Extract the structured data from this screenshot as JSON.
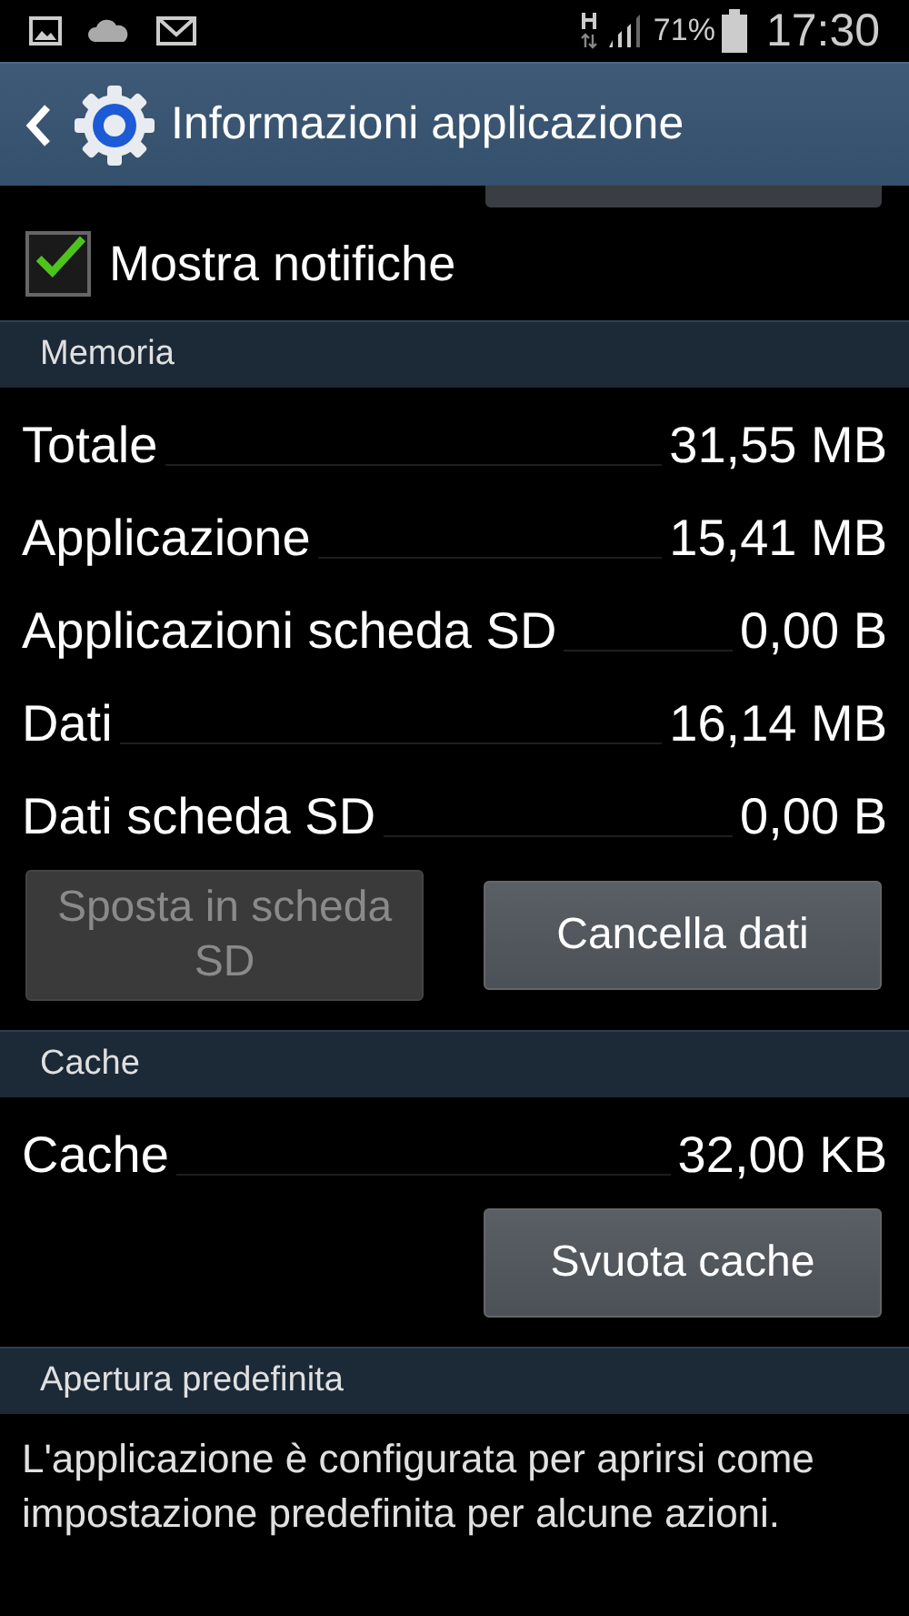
{
  "status_bar": {
    "battery": "71%",
    "time": "17:30"
  },
  "header": {
    "title": "Informazioni applicazione"
  },
  "notifications": {
    "label": "Mostra notifiche",
    "checked": true
  },
  "sections": [
    {
      "title": "Memoria",
      "rows": [
        {
          "label": "Totale",
          "value": "31,55 MB"
        },
        {
          "label": "Applicazione",
          "value": "15,41 MB"
        },
        {
          "label": "Applicazioni scheda SD",
          "value": "0,00 B"
        },
        {
          "label": "Dati",
          "value": "16,14 MB"
        },
        {
          "label": "Dati scheda SD",
          "value": "0,00 B"
        }
      ],
      "buttons": [
        {
          "label": "Sposta in scheda SD",
          "disabled": true
        },
        {
          "label": "Cancella dati",
          "disabled": false
        }
      ]
    },
    {
      "title": "Cache",
      "rows": [
        {
          "label": "Cache",
          "value": "32,00 KB"
        }
      ],
      "buttons": [
        {
          "label": "Svuota cache",
          "disabled": false
        }
      ]
    },
    {
      "title": "Apertura predefinita",
      "text": "L'applicazione è configurata per aprirsi come impostazione predefinita per alcune azioni."
    }
  ]
}
